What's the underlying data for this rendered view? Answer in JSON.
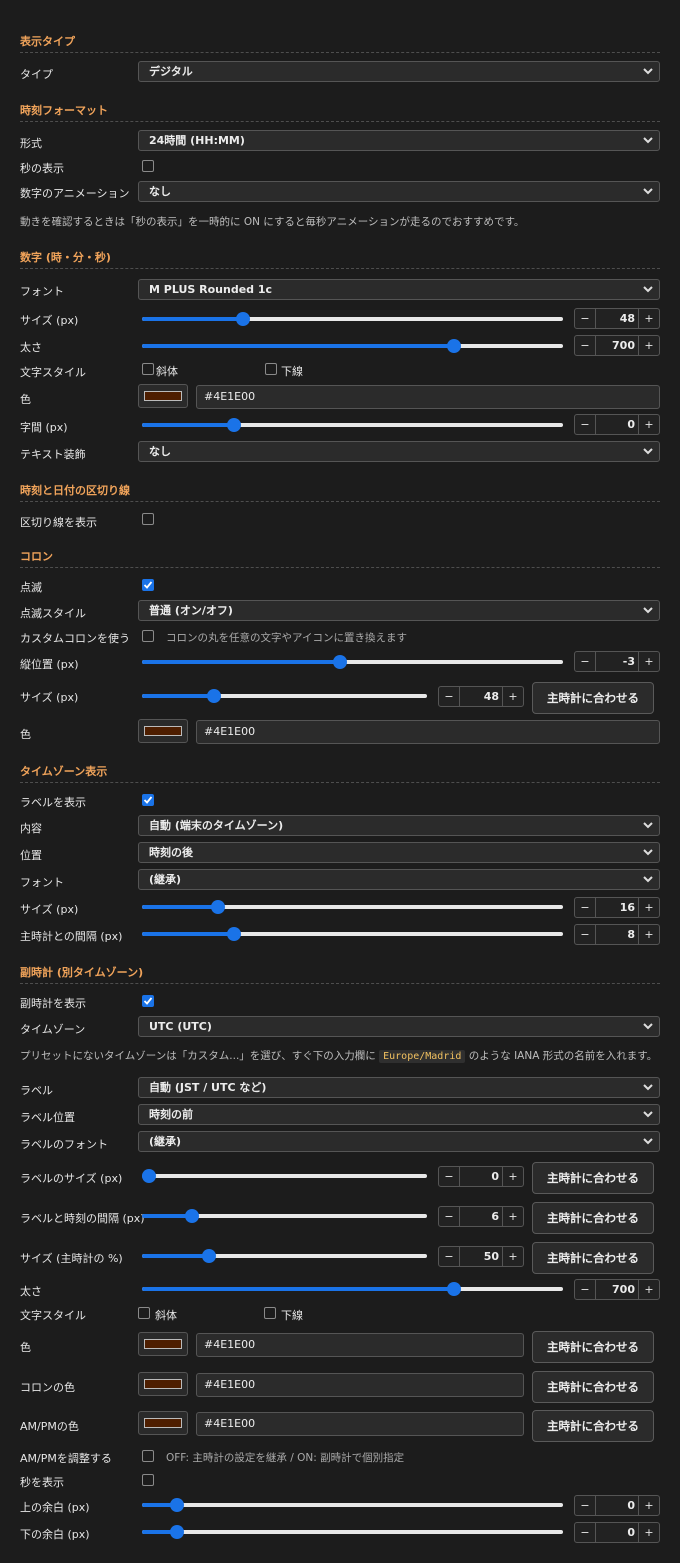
{
  "s_display": {
    "title": "表示タイプ",
    "type_label": "タイプ",
    "type_value": "デジタル"
  },
  "s_format": {
    "title": "時刻フォーマット",
    "format_label": "形式",
    "format_value": "24時間 (HH:MM)",
    "seconds_label": "秒の表示",
    "seconds_checked": false,
    "anim_label": "数字のアニメーション",
    "anim_value": "なし",
    "note": "動きを確認するときは「秒の表示」を一時的に ON にすると毎秒アニメーションが走るのでおすすめです。"
  },
  "s_digits": {
    "title": "数字 (時・分・秒)",
    "font_label": "フォント",
    "font_value": "M PLUS Rounded 1c",
    "size_label": "サイズ (px)",
    "size_value": "48",
    "size_level": 0.23,
    "weight_label": "太さ",
    "weight_value": "700",
    "weight_level": 0.75,
    "style_label": "文字スタイル",
    "italic": "斜体",
    "underline": "下線",
    "color_label": "色",
    "color_value": "#4E1E00",
    "spacing_label": "字間 (px)",
    "spacing_value": "0",
    "spacing_level": 0.21,
    "deco_label": "テキスト装飾",
    "deco_value": "なし"
  },
  "s_divider": {
    "title": "時刻と日付の区切り線",
    "show_label": "区切り線を表示",
    "show_checked": false
  },
  "s_colon": {
    "title": "コロン",
    "blink_label": "点滅",
    "blink_checked": true,
    "blink_style_label": "点滅スタイル",
    "blink_style_value": "普通 (オン/オフ)",
    "custom_label": "カスタムコロンを使う",
    "custom_checked": false,
    "custom_hint": "コロンの丸を任意の文字やアイコンに置き換えます",
    "vpos_label": "縦位置 (px)",
    "vpos_value": "-3",
    "vpos_level": 0.47,
    "size_label": "サイズ (px)",
    "size_value": "48",
    "size_level": 0.24,
    "match_button": "主時計に合わせる",
    "color_label": "色",
    "color_value": "#4E1E00"
  },
  "s_tz": {
    "title": "タイムゾーン表示",
    "show_label": "ラベルを表示",
    "show_checked": true,
    "content_label": "内容",
    "content_value": "自動 (端末のタイムゾーン)",
    "pos_label": "位置",
    "pos_value": "時刻の後",
    "font_label": "フォント",
    "font_value": "(継承)",
    "size_label": "サイズ (px)",
    "size_value": "16",
    "size_level": 0.17,
    "gap_label": "主時計との間隔 (px)",
    "gap_value": "8",
    "gap_level": 0.21
  },
  "s_sub": {
    "title": "副時計 (別タイムゾーン)",
    "show_label": "副時計を表示",
    "show_checked": true,
    "tz_label": "タイムゾーン",
    "tz_value": "UTC (UTC)",
    "note_pre": "プリセットにないタイムゾーンは「カスタム...」を選び、すぐ下の入力欄に",
    "note_code": "Europe/Madrid",
    "note_post": "のような IANA 形式の名前を入れます。",
    "label_label": "ラベル",
    "label_value": "自動 (JST / UTC など)",
    "label_pos_label": "ラベル位置",
    "label_pos_value": "時刻の前",
    "label_font_label": "ラベルのフォント",
    "label_font_value": "(継承)",
    "label_size_label": "ラベルのサイズ (px)",
    "label_size_value": "0",
    "label_size_level": 0.0,
    "label_gap_label": "ラベルと時刻の間隔 (px)",
    "label_gap_value": "6",
    "label_gap_level": 0.16,
    "size_pct_label": "サイズ (主時計の %)",
    "size_pct_value": "50",
    "size_pct_level": 0.22,
    "weight_label": "太さ",
    "weight_value": "700",
    "weight_level": 0.75,
    "style_label": "文字スタイル",
    "italic": "斜体",
    "underline": "下線",
    "color_label": "色",
    "color_value": "#4E1E00",
    "colon_color_label": "コロンの色",
    "colon_color_value": "#4E1E00",
    "ampm_color_label": "AM/PMの色",
    "ampm_color_value": "#4E1E00",
    "match_button": "主時計に合わせる",
    "ampm_adjust_label": "AM/PMを調整する",
    "ampm_adjust_checked": false,
    "ampm_adjust_hint": "OFF: 主時計の設定を継承 / ON: 副時計で個別指定",
    "seconds_label": "秒を表示",
    "seconds_checked": false,
    "top_margin_label": "上の余白 (px)",
    "top_margin_value": "0",
    "top_margin_level": 0.07,
    "bottom_margin_label": "下の余白 (px)",
    "bottom_margin_value": "0",
    "bottom_margin_level": 0.07
  },
  "colors": {
    "accent": "#1a73e8",
    "heading": "#f0a35a",
    "swatch": "#4E1E00"
  },
  "icons": {
    "select": "chevron-down-icon",
    "check": "checkmark-icon",
    "minus": "minus-icon",
    "plus": "plus-icon"
  }
}
